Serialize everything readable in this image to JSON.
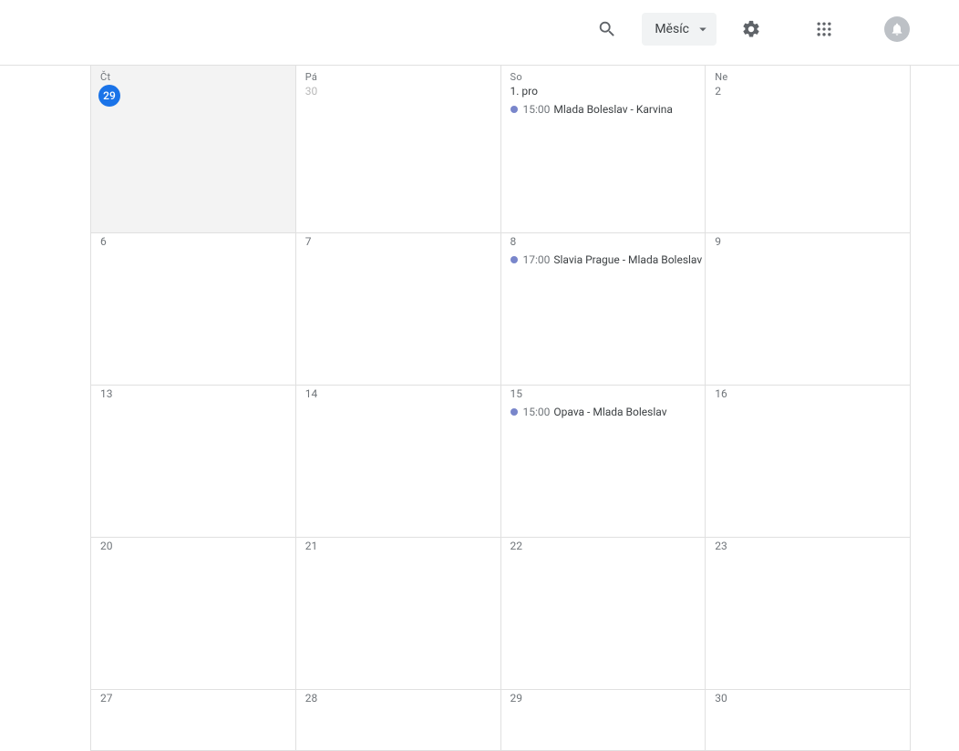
{
  "toolbar": {
    "view_label": "Měsíc"
  },
  "columns": [
    "Čt",
    "Pá",
    "So",
    "Ne"
  ],
  "weeks": [
    [
      {
        "num": "29",
        "today": true,
        "dim": false,
        "events": []
      },
      {
        "num": "30",
        "today": false,
        "dim": true,
        "events": []
      },
      {
        "num": "1. pro",
        "today": false,
        "dim": false,
        "monthFirst": true,
        "events": [
          {
            "time": "15:00",
            "title": "Mlada Boleslav - Karvina"
          }
        ]
      },
      {
        "num": "2",
        "today": false,
        "dim": false,
        "events": []
      }
    ],
    [
      {
        "num": "6",
        "events": []
      },
      {
        "num": "7",
        "events": []
      },
      {
        "num": "8",
        "events": [
          {
            "time": "17:00",
            "title": "Slavia Prague - Mlada Boleslav"
          }
        ]
      },
      {
        "num": "9",
        "events": []
      }
    ],
    [
      {
        "num": "13",
        "events": []
      },
      {
        "num": "14",
        "events": []
      },
      {
        "num": "15",
        "events": [
          {
            "time": "15:00",
            "title": "Opava - Mlada Boleslav"
          }
        ]
      },
      {
        "num": "16",
        "events": []
      }
    ],
    [
      {
        "num": "20",
        "events": []
      },
      {
        "num": "21",
        "events": []
      },
      {
        "num": "22",
        "events": []
      },
      {
        "num": "23",
        "events": []
      }
    ],
    [
      {
        "num": "27",
        "events": []
      },
      {
        "num": "28",
        "events": []
      },
      {
        "num": "29",
        "events": []
      },
      {
        "num": "30",
        "events": []
      }
    ]
  ],
  "eventDotColor": "#7986cb"
}
